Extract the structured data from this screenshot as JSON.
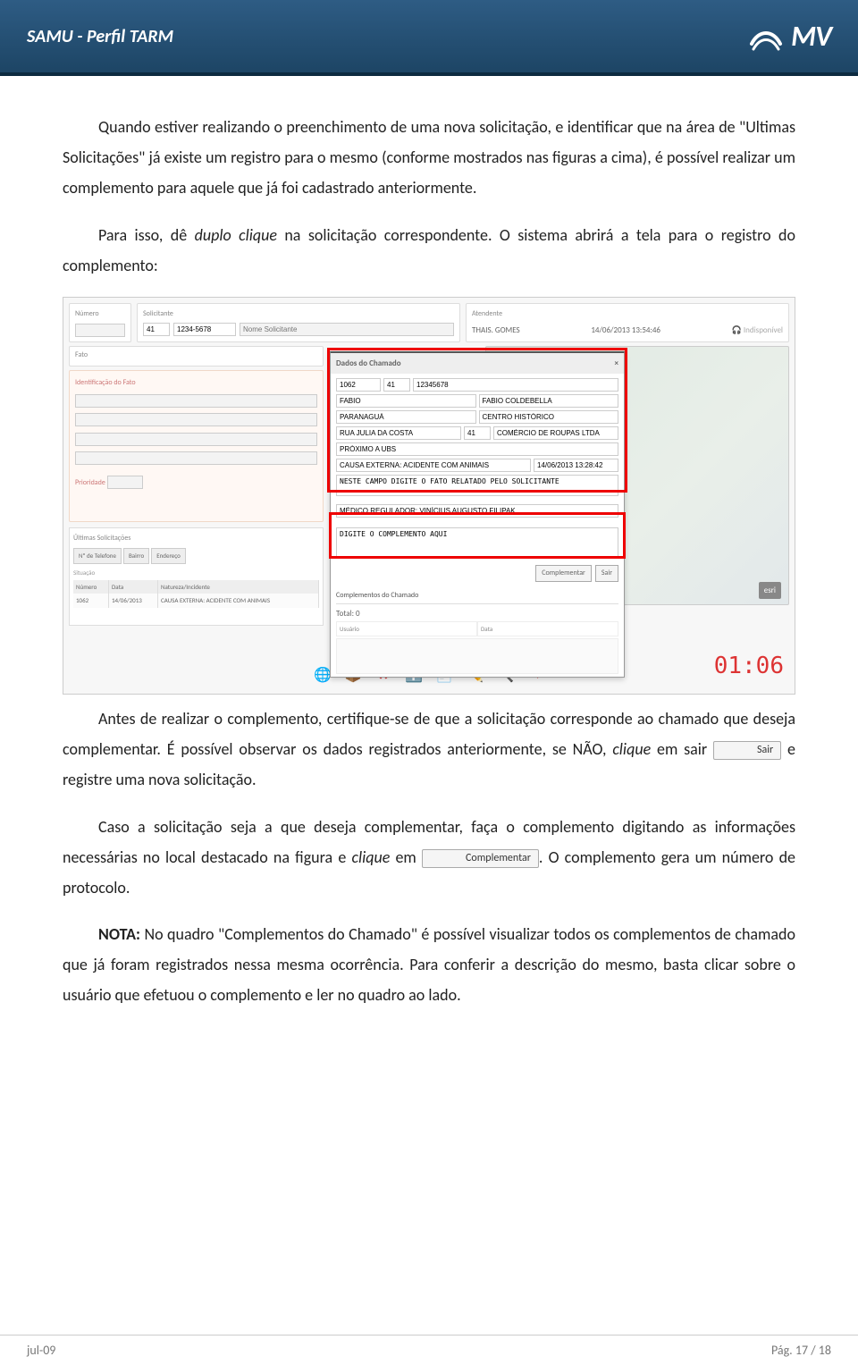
{
  "header": {
    "title": "SAMU  - Perfil TARM",
    "logo_text": "MV"
  },
  "body": {
    "p1": "Quando estiver realizando o preenchimento de uma nova solicitação, e identificar que na área de \"Ultimas Solicitações\" já existe um registro para o mesmo (conforme mostrados nas figuras a cima), é possível realizar um complemento para aquele que já foi cadastrado anteriormente.",
    "p2_a": "Para isso, dê ",
    "p2_b": "duplo clique",
    "p2_c": " na solicitação correspondente. O sistema abrirá a tela para o registro do complemento:",
    "p3_a": "Antes de realizar o complemento, certifique-se de que a solicitação corresponde ao chamado que deseja complementar. É possível observar os dados registrados anteriormente, se NÃO, ",
    "p3_b": "clique",
    "p3_c": " em sair ",
    "p3_d": " e registre uma nova solicitação.",
    "p4_a": "Caso a solicitação seja a que deseja complementar, faça o complemento digitando as informações necessárias no local destacado na figura e ",
    "p4_b": "clique",
    "p4_c": " em ",
    "p4_d": ". O complemento gera um número de protocolo.",
    "p5_a": "NOTA:",
    "p5_b": " No quadro \"Complementos do Chamado\" é possível visualizar todos os complementos de chamado que já foram registrados nessa mesma ocorrência. Para conferir a descrição do mesmo, basta clicar sobre o usuário que efetuou o complemento e ler no quadro ao lado.",
    "btn_sair": "Sair",
    "btn_compl": "Complementar"
  },
  "mock": {
    "labels": {
      "numero": "Número",
      "solicitante": "Solicitante",
      "atendente": "Atendente",
      "fato": "Fato",
      "ident_fato": "Identificação do Fato",
      "prioridade": "Prioridade",
      "ultimas": "Últimas Solicitações",
      "situacao": "Situação",
      "th_num": "Número",
      "th_data": "Data",
      "th_nat": "Natureza/Incidente",
      "dlg_title": "Dados do Chamado",
      "compl_btn": "Complementar",
      "sair_btn": "Sair",
      "compl_hdr": "Complementos do Chamado",
      "total": "Total: 0",
      "usuario": "Usuário",
      "data": "Data",
      "esri": "esri"
    },
    "tabs": {
      "tel": "Nº de Telefone",
      "bairro": "Bairro",
      "end": "Endereço"
    },
    "fields": {
      "tel_ddd": "41",
      "tel_num": "1234-5678",
      "sol_placeholder": "Nome Solicitante",
      "atendente_nome": "THAIS. GOMES",
      "atendente_ts": "14/06/2013 13:54:46",
      "atendente_status": "Indisponível",
      "f_id": "1062",
      "f_ddd": "41",
      "f_tel": "12345678",
      "f_nome1": "FABIO",
      "f_nome2": "FABIO COLDEBELLA",
      "f_cidade": "PARANAGUÁ",
      "f_bairro": "CENTRO HISTÓRICO",
      "f_rua": "RUA JULIA DA COSTA",
      "f_num": "41",
      "f_ref": "COMÉRCIO DE ROUPAS LTDA",
      "f_prox": "PRÓXIMO A UBS",
      "f_causa": "CAUSA EXTERNA: ACIDENTE COM ANIMAIS",
      "f_ts": "14/06/2013 13:28:42",
      "f_obs": "NESTE CAMPO DIGITE O FATO RELATADO PELO SOLICITANTE",
      "f_med": "MÉDICO REGULADOR: VINÍCIUS AUGUSTO FILIPAK",
      "f_compl": "DIGITE O COMPLEMENTO AQUI",
      "row_num": "1062",
      "row_data": "14/06/2013",
      "row_nat": "CAUSA EXTERNA: ACIDENTE COM ANIMAIS",
      "timer": "01:06"
    }
  },
  "footer": {
    "left": "jul-09",
    "right": "Pág. 17 / 18"
  }
}
